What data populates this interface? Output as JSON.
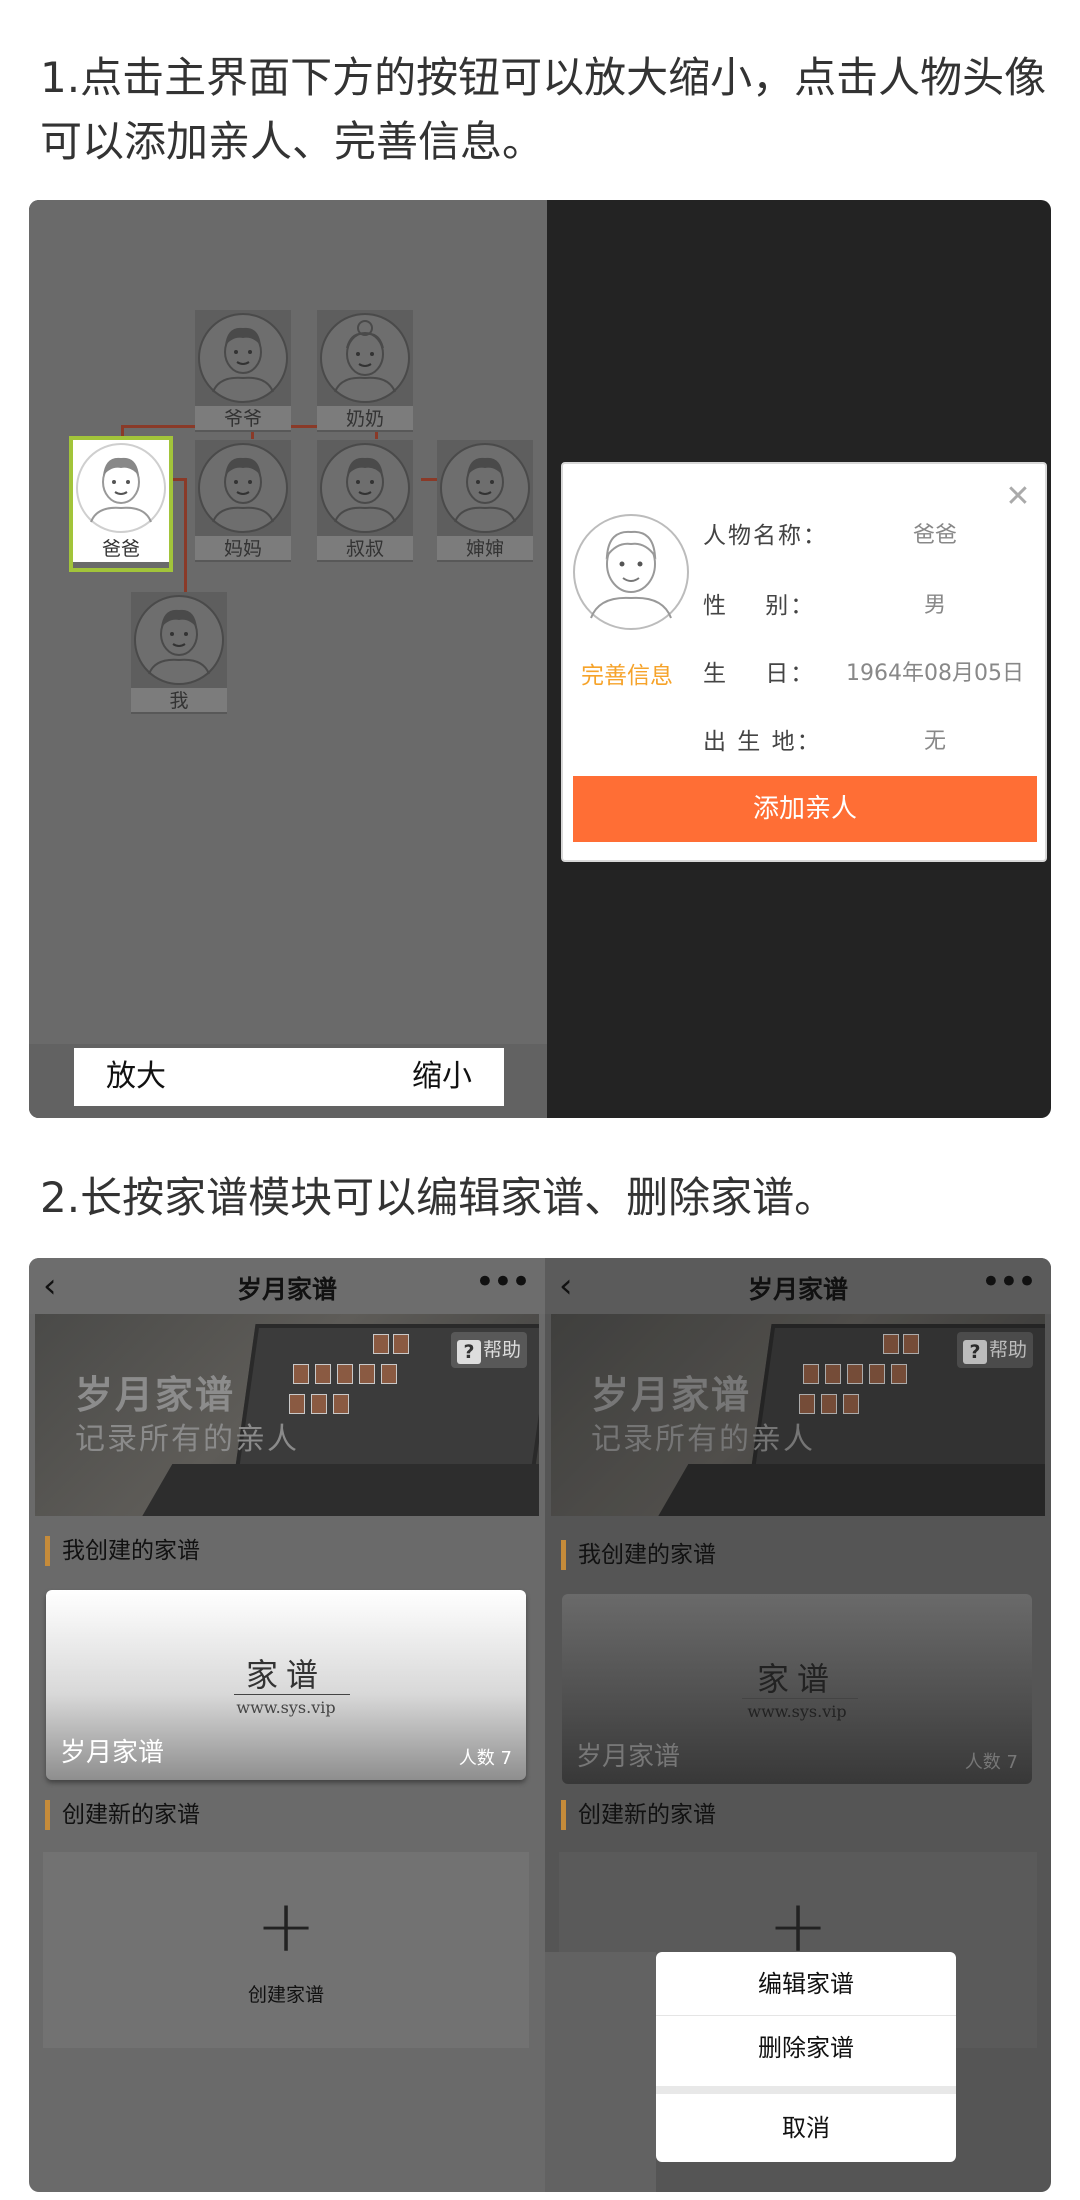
{
  "instructions": {
    "step1": "1.点击主界面下方的按钮可以放大缩小，点击人物头像可以添加亲人、完善信息。",
    "step2": "2.长按家谱模块可以编辑家谱、删除家谱。"
  },
  "tree": {
    "members": [
      {
        "id": "grandpa",
        "label": "爷爷"
      },
      {
        "id": "grandma",
        "label": "奶奶"
      },
      {
        "id": "dad",
        "label": "爸爸",
        "selected": true
      },
      {
        "id": "mom",
        "label": "妈妈"
      },
      {
        "id": "uncle",
        "label": "叔叔"
      },
      {
        "id": "aunt",
        "label": "婶婶"
      },
      {
        "id": "me",
        "label": "我"
      }
    ],
    "zoom_in": "放大",
    "zoom_out": "缩小",
    "line_color": "#8a3a28",
    "selected_color": "#a2c43a"
  },
  "popup": {
    "close_icon": "close-icon",
    "perfect_info": "完善信息",
    "fields": [
      {
        "key": "人物名称：",
        "value": "爸爸"
      },
      {
        "key": "性    别：",
        "value": "男"
      },
      {
        "key": "生    日：",
        "value": "1964年08月05日"
      },
      {
        "key": "出 生 地：",
        "value": "无"
      }
    ],
    "add_relative": "添加亲人",
    "accent": "#ff6e35",
    "info_color": "#f6a32a"
  },
  "app": {
    "title": "岁月家谱",
    "back_icon": "chevron-left-icon",
    "more_icon": "more-dots-icon",
    "banner_title": "岁月家谱",
    "banner_subtitle": "记录所有的亲人",
    "help": "帮助",
    "my_section": "我创建的家谱",
    "card_logo": "家谱",
    "card_url": "www.sys.vip",
    "card_name": "岁月家谱",
    "card_count": "人数 7",
    "new_section": "创建新的家谱",
    "create_label": "创建家谱",
    "plus_icon": "plus-icon"
  },
  "action_sheet": {
    "edit": "编辑家谱",
    "delete": "删除家谱",
    "cancel": "取消"
  }
}
